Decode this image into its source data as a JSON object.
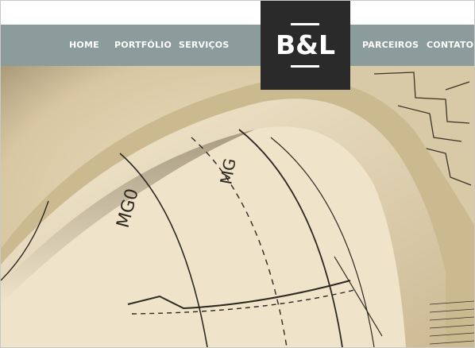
{
  "nav": {
    "home": "HOME",
    "portfolio": "PORTFÓLIO",
    "servicos": "SERVIÇOS",
    "parceiros": "PARCEIROS",
    "contato": "CONTATO"
  },
  "logo": {
    "text": "B&L"
  },
  "colors": {
    "navbar": "#8c9c9c",
    "logo_bg": "#2a2a2a",
    "paper": "#e6d8b8"
  }
}
